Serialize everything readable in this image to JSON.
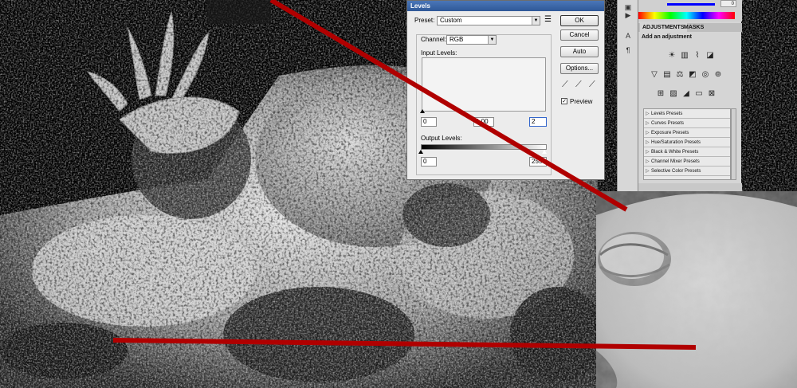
{
  "levels_dialog": {
    "title": "Levels",
    "preset_label": "Preset:",
    "preset_value": "Custom",
    "channel_label": "Channel:",
    "channel_value": "RGB",
    "input_levels_label": "Input Levels:",
    "input_black": "0",
    "input_gamma": "1,00",
    "input_white": "2",
    "output_levels_label": "Output Levels:",
    "output_black": "0",
    "output_white": "255",
    "ok_label": "OK",
    "cancel_label": "Cancel",
    "auto_label": "Auto",
    "options_label": "Options...",
    "preview_label": "Preview",
    "preview_checked": true
  },
  "adjustments_panel": {
    "tab_adjustments": "ADJUSTMENTS",
    "tab_masks": "MASKS",
    "heading": "Add an adjustment",
    "color_value": "0",
    "presets": [
      "Levels Presets",
      "Curves Presets",
      "Exposure Presets",
      "Hue/Saturation Presets",
      "Black & White Presets",
      "Channel Mixer Presets",
      "Selective Color Presets"
    ]
  },
  "colors": {
    "annotation_line": "#b00000",
    "dialog_bg": "#ececec",
    "titlebar": "#2f5897"
  }
}
